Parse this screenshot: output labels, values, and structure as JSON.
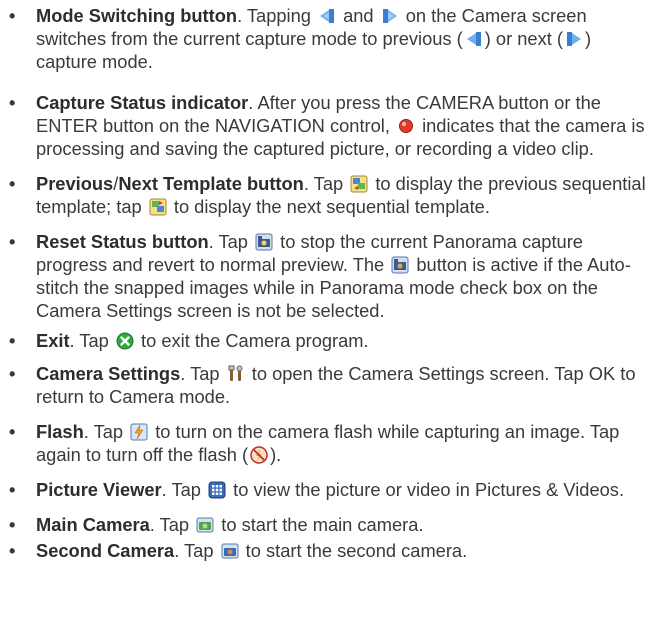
{
  "items": [
    {
      "title": "Mode Switching button",
      "t1": ". Tapping ",
      "t2": " and ",
      "t3": " on the Camera screen switches from the current capture mode to previous (",
      "t4": ") or next (",
      "t5": ") capture mode.",
      "icons": [
        "mode-left-arrow-icon",
        "mode-right-arrow-icon"
      ]
    },
    {
      "title": "Capture Status indicator",
      "t1": ". After you press the CAMERA button or the ENTER button on the NAVIGATION control, ",
      "t2": " indicates that the camera is processing and saving the captured picture, or recording a video clip.",
      "icons": [
        "red-dot-icon"
      ]
    },
    {
      "title": "Previous",
      "sep": "/",
      "title2": "Next Template button",
      "t1": ". Tap ",
      "t2": " to display the previous sequential template; tap ",
      "t3": " to display the next sequential template.",
      "icons": [
        "previous-template-icon",
        "next-template-icon"
      ]
    },
    {
      "title": "Reset Status button",
      "t1": ". Tap ",
      "t2": " to stop the current Panorama capture progress and revert to normal preview. The ",
      "t3": " button is active if the Auto-stitch the snapped images while in Panorama mode check box on the Camera Settings screen is not be selected.",
      "icons": [
        "reset-status-icon"
      ]
    },
    {
      "title": "Exit",
      "t1": ". Tap ",
      "t2": " to exit the Camera program.",
      "icons": [
        "exit-icon"
      ]
    },
    {
      "title": "Camera Settings",
      "t1": ". Tap ",
      "t2": " to open the Camera Settings screen. Tap OK to return to Camera mode.",
      "icons": [
        "settings-tools-icon"
      ]
    },
    {
      "title": "Flash",
      "t1": ". Tap ",
      "t2": " to turn on the camera flash while capturing an image. Tap again to turn off the flash (",
      "t3": ").",
      "icons": [
        "flash-on-icon",
        "flash-off-icon"
      ]
    },
    {
      "title": "Picture Viewer",
      "t1": ". Tap ",
      "t2": " to view the picture or video in Pictures & Videos.",
      "icons": [
        "picture-viewer-icon"
      ]
    },
    {
      "title": "Main Camera",
      "t1": ". Tap ",
      "t2": " to start the main camera.",
      "icons": [
        "main-camera-icon"
      ]
    },
    {
      "title": "Second Camera",
      "t1": ". Tap ",
      "t2": " to start the second camera.",
      "icons": [
        "second-camera-icon"
      ]
    }
  ],
  "bullet": "•",
  "colors": {
    "text": "#3a3a3a",
    "icon_blue": "#3a7fd6",
    "icon_red": "#e03a2a",
    "icon_green": "#2eaa3a"
  }
}
